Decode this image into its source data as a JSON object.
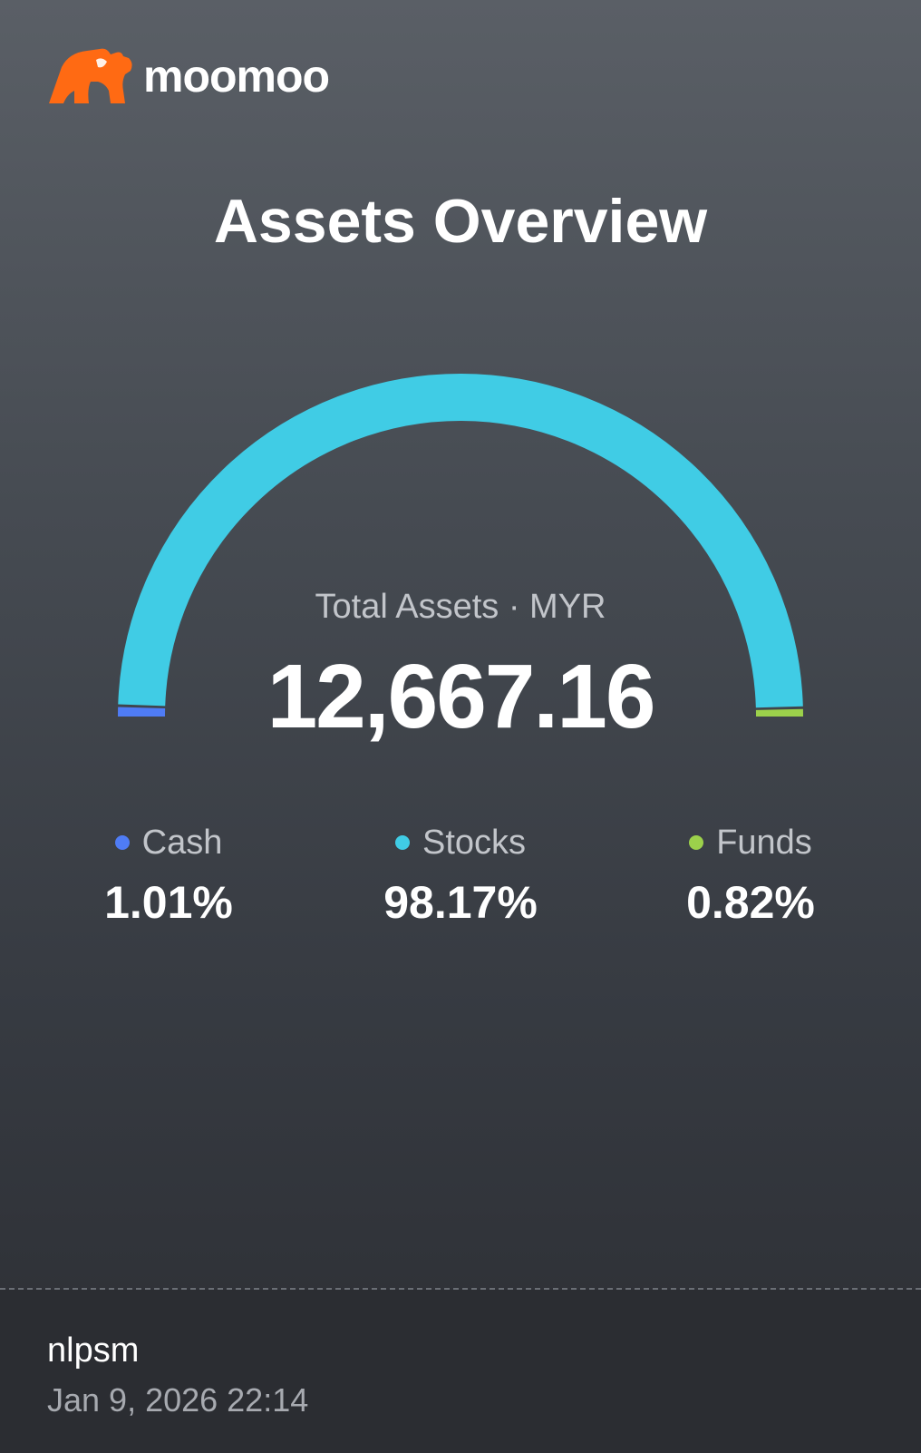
{
  "brand": {
    "name": "moomoo",
    "logo_icon": "bull-logo-icon",
    "logo_color": "#ff6a13"
  },
  "title": "Assets Overview",
  "total": {
    "label": "Total Assets · MYR",
    "value": "12,667.16"
  },
  "gauge": {
    "shares": [
      {
        "name": "Cash",
        "percent": 1.01,
        "color": "#4f7cf5"
      },
      {
        "name": "Stocks",
        "percent": 98.17,
        "color": "#40cce5"
      },
      {
        "name": "Funds",
        "percent": 0.82,
        "color": "#9cd14b"
      }
    ]
  },
  "breakdown": [
    {
      "label": "Cash",
      "percent": "1.01%",
      "color": "#4f7cf5"
    },
    {
      "label": "Stocks",
      "percent": "98.17%",
      "color": "#40cce5"
    },
    {
      "label": "Funds",
      "percent": "0.82%",
      "color": "#9cd14b"
    }
  ],
  "footer": {
    "username": "nlpsm",
    "timestamp": "Jan 9, 2026 22:14"
  }
}
